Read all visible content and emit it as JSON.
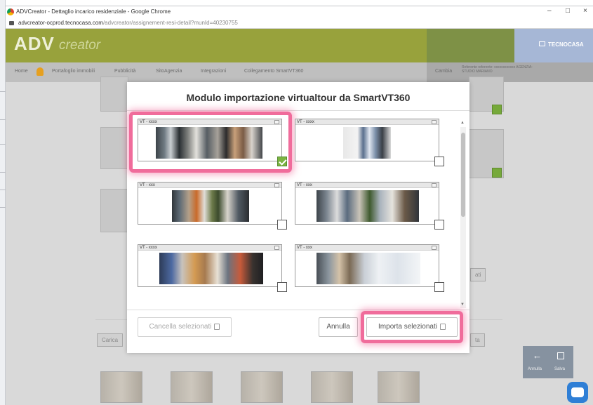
{
  "window": {
    "title": "ADVCreator - Dettaglio incarico residenziale - Google Chrome",
    "controls": [
      "–",
      "□",
      "×"
    ]
  },
  "browser": {
    "url_host": "advcreator-ocprod.tecnocasa.com",
    "url_path": "/advcreator/assignement-resi-detail?munId=40230755"
  },
  "app": {
    "logo_main": "ADV",
    "logo_sub": "creator",
    "brand": "TECNOCASA"
  },
  "nav": {
    "items": [
      "Home",
      "Portafoglio immobili",
      "Pubblicità",
      "SitoAgenzia",
      "Integrazioni",
      "Collegamento SmartVT360"
    ],
    "right_label": "Cambia",
    "right_info": "Referente referente: xxxxxxxxxxxx AGENZIA: STUDIO MARIANO"
  },
  "background": {
    "left_button": "Carica",
    "right_button_1": "ati",
    "right_button_2": "ta",
    "side_actions": [
      "Annulla",
      "Salva"
    ]
  },
  "modal": {
    "title": "Modulo importazione virtualtour da SmartVT360",
    "tours": [
      {
        "label": "VT - xxxx",
        "checked": true
      },
      {
        "label": "VT - xxxx",
        "checked": false
      },
      {
        "label": "VT - xxx",
        "checked": false
      },
      {
        "label": "VT - xxx",
        "checked": false
      },
      {
        "label": "VT - xxxx",
        "checked": false
      },
      {
        "label": "VT - xxx",
        "checked": false
      }
    ],
    "buttons": {
      "delete_selected": "Cancella selezionati",
      "cancel": "Annulla",
      "import_selected": "Importa selezionati"
    }
  },
  "colors": {
    "header_olive": "#98a23c",
    "highlight_pink": "#f06c9b",
    "check_green": "#7cb342"
  }
}
